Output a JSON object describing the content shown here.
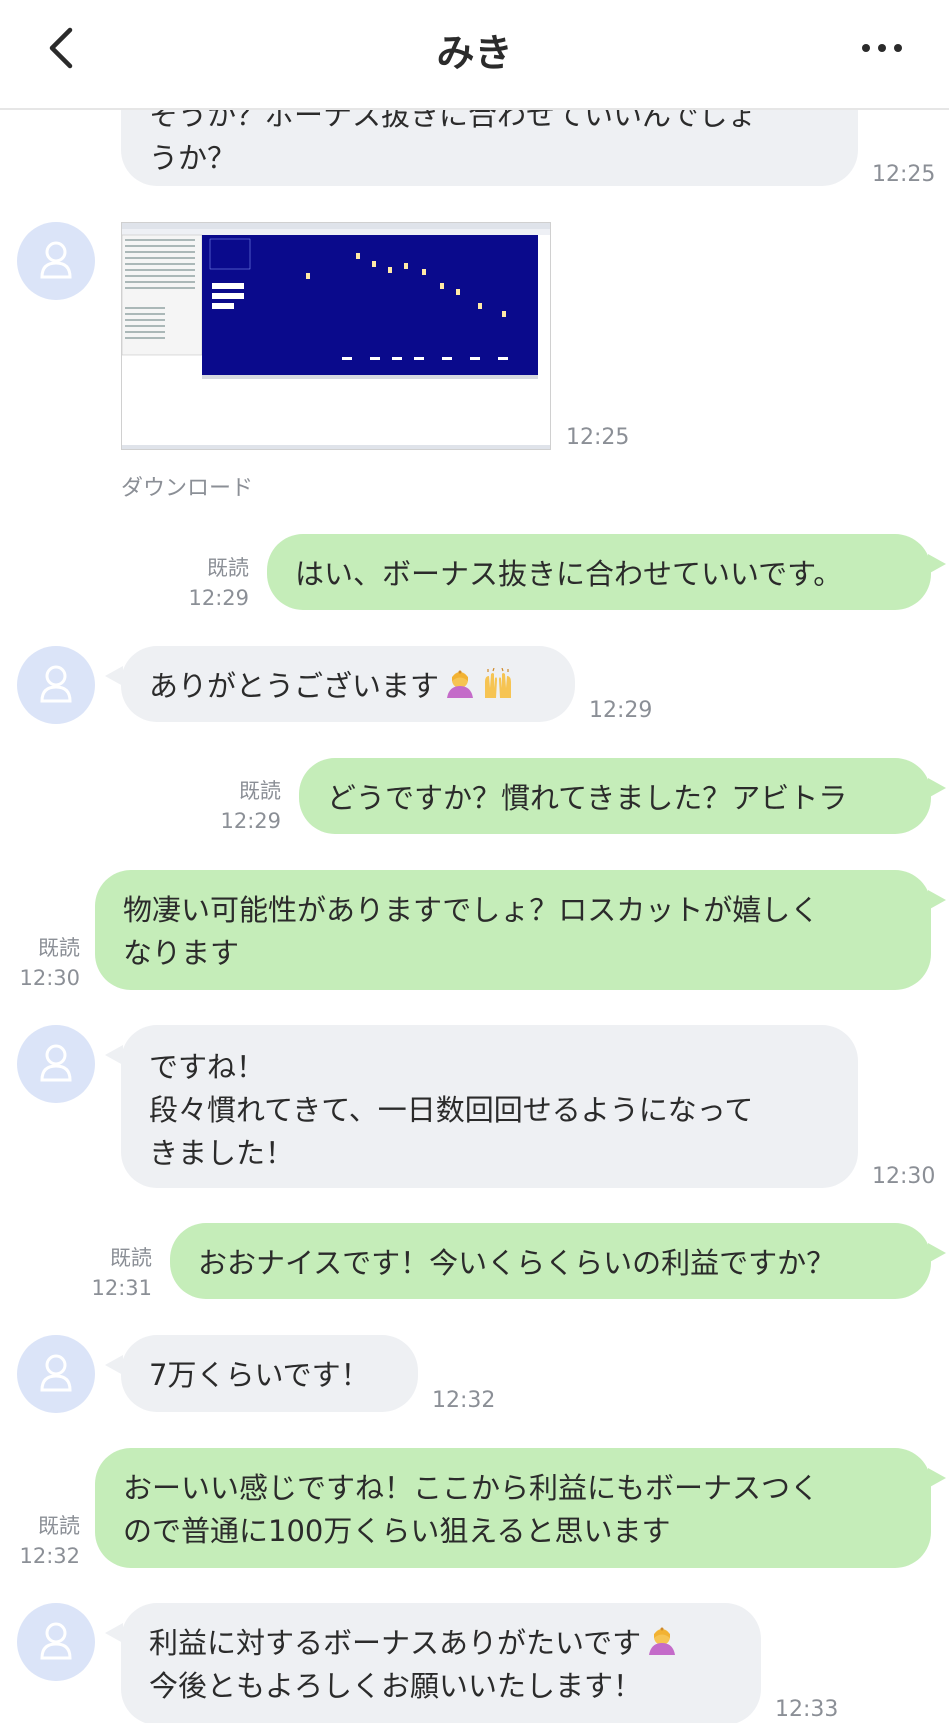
{
  "header": {
    "title": "みき",
    "back_icon": "chevron-left-icon",
    "more_icon": "more-horizontal-icon"
  },
  "messages": [
    {
      "side": "in",
      "lines": [
        "そうか？ボーナス抜きに合わせていいんでしょ",
        "うか？"
      ],
      "time": "12:25"
    },
    {
      "side": "in",
      "type": "image",
      "time": "12:25",
      "download_label": "ダウンロード"
    },
    {
      "side": "out",
      "lines": [
        "はい、ボーナス抜きに合わせていいです。"
      ],
      "read": "既読",
      "time": "12:29"
    },
    {
      "side": "in",
      "lines": [
        "ありがとうございます"
      ],
      "emojis": [
        "woman-bowing-emoji",
        "raised-hands-emoji"
      ],
      "time": "12:29"
    },
    {
      "side": "out",
      "lines": [
        "どうですか？慣れてきました？アビトラ"
      ],
      "read": "既読",
      "time": "12:29"
    },
    {
      "side": "out",
      "lines": [
        "物凄い可能性がありますでしょ？ロスカットが嬉しく",
        "なります"
      ],
      "read": "既読",
      "time": "12:30"
    },
    {
      "side": "in",
      "lines": [
        "ですね！",
        "段々慣れてきて、一日数回回せるようになって",
        "きました！"
      ],
      "time": "12:30"
    },
    {
      "side": "out",
      "lines": [
        "おおナイスです！今いくらくらいの利益ですか？"
      ],
      "read": "既読",
      "time": "12:31"
    },
    {
      "side": "in",
      "lines": [
        "7万くらいです！"
      ],
      "time": "12:32"
    },
    {
      "side": "out",
      "lines": [
        "おーいい感じですね！ここから利益にもボーナスつく",
        "ので普通に100万くらい狙えると思います"
      ],
      "read": "既読",
      "time": "12:32"
    },
    {
      "side": "in",
      "lines": [
        "利益に対するボーナスありがたいです",
        "今後ともよろしくお願いいたします！"
      ],
      "emojis": [
        "woman-bowing-emoji"
      ],
      "time": "12:33"
    }
  ],
  "colors": {
    "incoming_bubble": "#eef0f3",
    "outgoing_bubble": "#c5edb9",
    "avatar_bg": "#dbe4f8",
    "meta_text": "#8b8f96"
  }
}
